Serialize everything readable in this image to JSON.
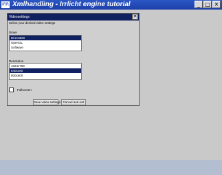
{
  "window": {
    "title": "Xmlhandling - Irrlicht engine tutorial",
    "icon_label": "IRR",
    "minimize": "_",
    "maximize": "□",
    "close": "✕"
  },
  "dialog": {
    "title": "Videosettings",
    "close": "✕",
    "subtitle": "Select your desired video settings",
    "driver_label": "Driver",
    "drivers": [
      "Direct3D9",
      "OpenGL",
      "Software"
    ],
    "selected_driver": 0,
    "resolution_label": "Resolution",
    "resolutions": [
      "1024x768",
      "640x480",
      "800x600"
    ],
    "selected_resolution": 1,
    "fullscreen_label": "Fullscreen",
    "fullscreen_checked": false,
    "save_button": "Save video settings",
    "cancel_button": "Cancel and exit"
  }
}
